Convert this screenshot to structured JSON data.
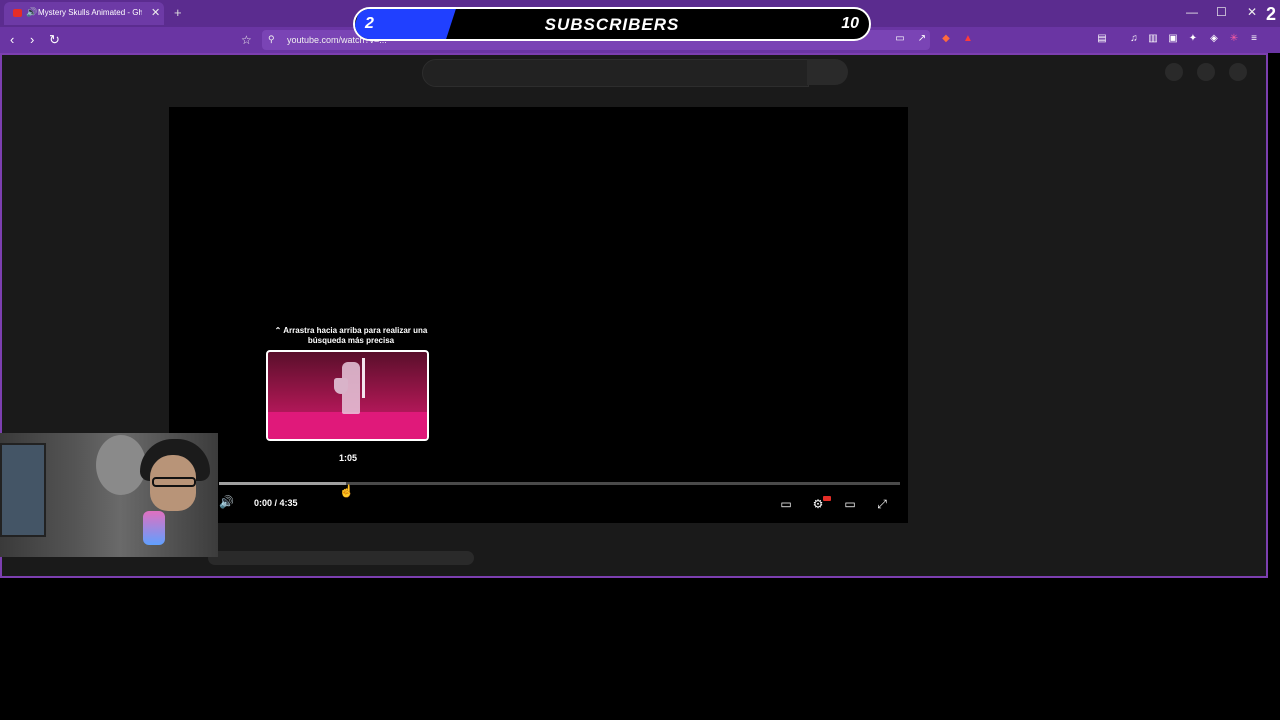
{
  "browser": {
    "tab_title": "Mystery Skulls Animated - Gh",
    "tab_speaker": "🔊",
    "tab_close": "✕",
    "new_tab": "+",
    "url": "youtube.com/watch?v=...",
    "window_controls": {
      "minimize": "—",
      "maximize": "☐",
      "close": "✕"
    },
    "nav": {
      "back": "‹",
      "forward": "›",
      "reload": "↻"
    },
    "bookmark_glyph": "🔖"
  },
  "subscriber_goal": {
    "current": "2",
    "label": "SUBSCRIBERS",
    "goal": "10",
    "progress_fraction": 0.2
  },
  "corner_number": "2",
  "player": {
    "drag_hint": "⌃ Arrastra hacia arriba para realizar una búsqueda más precisa",
    "preview_time": "1:05",
    "time_display": "0:00 / 4:35",
    "hover_fraction": 0.236,
    "controls": {
      "volume": "🔊",
      "subtitles": "▭",
      "settings": "⚙",
      "theater": "▭",
      "fullscreen": "⤢"
    }
  },
  "icons": [
    "youtube-favicon",
    "speaker-icon",
    "close-icon",
    "plus-icon",
    "back-icon",
    "forward-icon",
    "reload-icon",
    "bookmark-icon",
    "site-settings-icon",
    "gear-icon",
    "fullscreen-icon",
    "subtitles-icon",
    "theater-icon",
    "volume-icon"
  ],
  "colors": {
    "accent": "#6a35a3",
    "frame_border": "#7c3fb0",
    "goal_fill": "#2040ff",
    "youtube_red": "#e52d27"
  }
}
